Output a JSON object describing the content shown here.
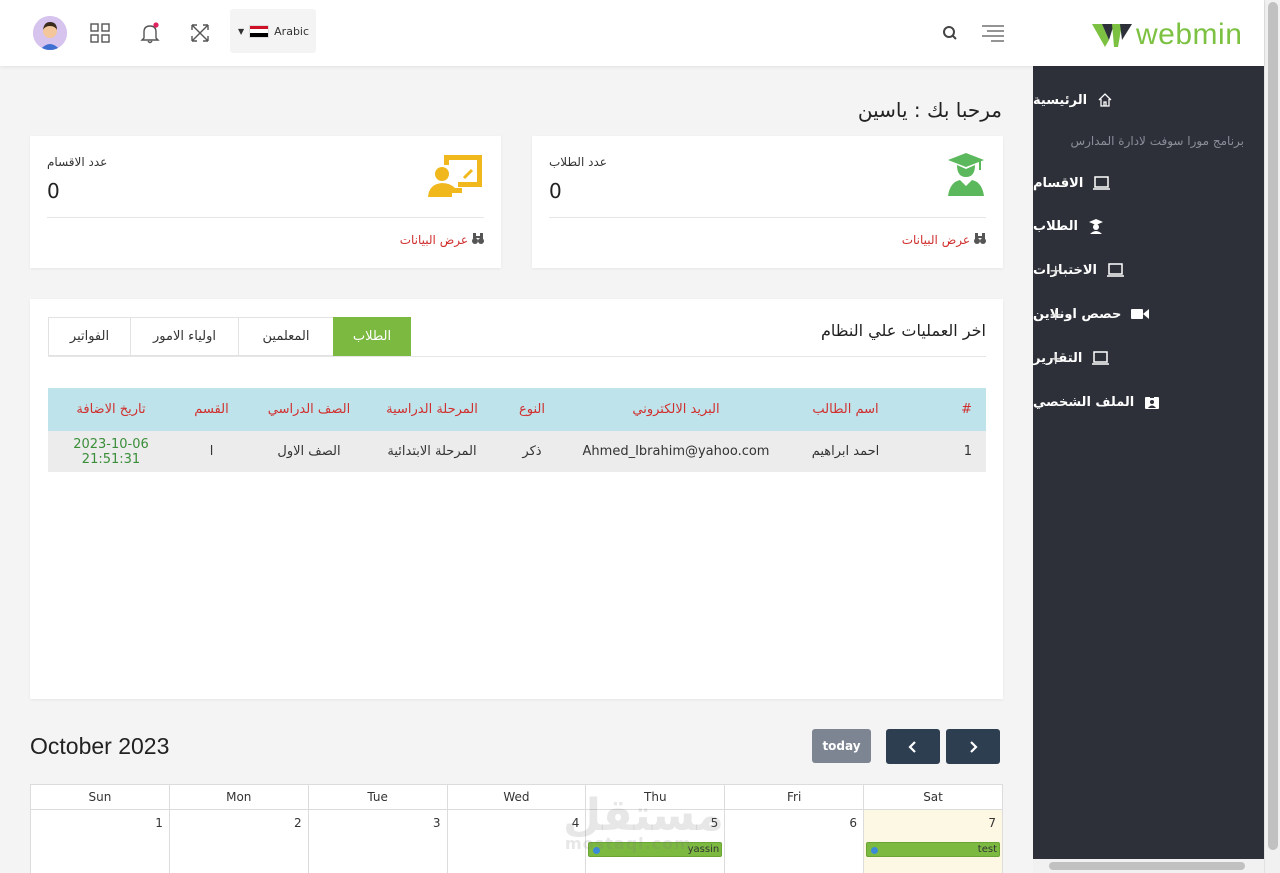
{
  "topbar": {
    "language": "Arabic",
    "logo_text": "webmin",
    "brand_color": "#7cc142"
  },
  "sidebar": {
    "items": [
      {
        "label": "الرئيسية",
        "icon": "home-icon"
      },
      {
        "label": "برنامج مورا سوفت لادارة المدارس",
        "icon": ""
      },
      {
        "label": "الاقسام",
        "icon": "laptop-icon"
      },
      {
        "label": "الطلاب",
        "icon": "student-icon"
      },
      {
        "label": "الاختبارات",
        "icon": "laptop-icon",
        "expand": "+"
      },
      {
        "label": "حصص اونلاين",
        "icon": "video-icon",
        "expand": "+"
      },
      {
        "label": "التقارير",
        "icon": "laptop-icon",
        "expand": "+"
      },
      {
        "label": "الملف الشخصي",
        "icon": "id-badge-icon"
      }
    ]
  },
  "welcome": "مرحبا بك : ياسين",
  "stats": {
    "students": {
      "label": "عدد الطلاب",
      "value": "0",
      "link": "عرض البيانات"
    },
    "sections": {
      "label": "عدد الاقسام",
      "value": "0",
      "link": "عرض البيانات"
    }
  },
  "operations": {
    "title": "اخر العمليات علي النظام",
    "tabs": [
      "الطلاب",
      "المعلمين",
      "اولياء الامور",
      "الفواتير"
    ],
    "columns": [
      "#",
      "اسم الطالب",
      "البريد الالكتروني",
      "النوع",
      "المرحلة الدراسية",
      "الصف الدراسي",
      "القسم",
      "تاريخ الاضافة"
    ],
    "rows": [
      [
        "1",
        "احمد ابراهيم",
        "Ahmed_Ibrahim@yahoo.com",
        "ذكر",
        "المرحلة الابتدائية",
        "الصف الاول",
        "ا",
        "2023-10-06 21:51:31"
      ]
    ]
  },
  "calendar": {
    "title": "October 2023",
    "today_label": "today",
    "prev": "‹",
    "next": "›",
    "weekdays": [
      "Sun",
      "Mon",
      "Tue",
      "Wed",
      "Thu",
      "Fri",
      "Sat"
    ],
    "days": [
      "1",
      "2",
      "3",
      "4",
      "5",
      "6",
      "7"
    ],
    "events": [
      {
        "day": "5",
        "label": "yassin"
      },
      {
        "day": "7",
        "label": "test"
      }
    ],
    "today_color": "#fcf8e3",
    "event_color": "#7cb941"
  },
  "watermark": {
    "main": "مستقل",
    "sub": "mostaql.com"
  }
}
